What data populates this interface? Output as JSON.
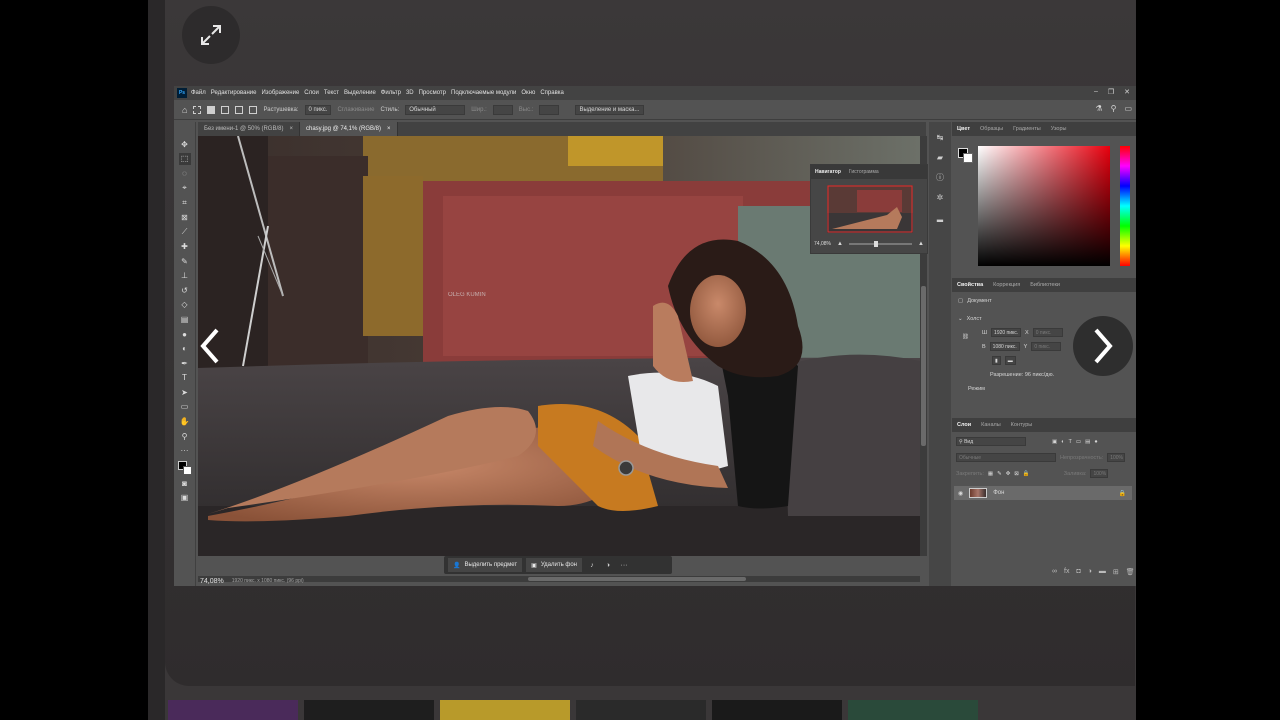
{
  "viewer": {
    "expand_icon": "expand-arrows-icon",
    "prev_icon": "chevron-left-icon",
    "next_icon": "chevron-right-icon"
  },
  "ps": {
    "logo": "Ps",
    "menu": [
      "Файл",
      "Редактирование",
      "Изображение",
      "Слои",
      "Текст",
      "Выделение",
      "Фильтр",
      "3D",
      "Просмотр",
      "Подключаемые модули",
      "Окно",
      "Справка"
    ],
    "window_controls": [
      "–",
      "❐",
      "✕"
    ],
    "options": {
      "feather_label": "Растушевка:",
      "feather_value": "0 пикс.",
      "antialias": "Сглаживание",
      "style_label": "Стиль:",
      "style_value": "Обычный",
      "width_label": "Шир.:",
      "height_label": "Выс.:",
      "select_mask_button": "Выделение и маска..."
    },
    "doc_tabs": [
      {
        "label": "Без имени-1 @ 50% (RGB/8)",
        "close": "×"
      },
      {
        "label": "chasy.jpg @ 74,1% (RGB/8)",
        "close": "×"
      }
    ],
    "status": {
      "zoom": "74,08%",
      "size": "1920 пикс. x 1080 пикс. (96 ppi)"
    },
    "context_bar": {
      "select_subject": "Выделить предмет",
      "remove_bg": "Удалить фон",
      "more": "···"
    },
    "navigator": {
      "tab_navigator": "Навигатор",
      "tab_histogram": "Гистограмма",
      "zoom": "74,08%"
    },
    "color_panel": {
      "tabs": [
        "Цвет",
        "Образцы",
        "Градиенты",
        "Узоры"
      ],
      "foreground": "#000000",
      "background": "#ffffff",
      "hue": "#e8000e"
    },
    "properties": {
      "tabs": [
        "Свойства",
        "Коррекция",
        "Библиотеки"
      ],
      "type": "Документ",
      "canvas_section": "Холст",
      "width": "1920 пикс.",
      "height": "1080 пикс.",
      "x_label": "X",
      "y_label": "Y",
      "x_value": "0 пикс.",
      "y_value": "0 пикс.",
      "w_label": "Ш",
      "h_label": "В",
      "resolution": "Разрешение: 96 пикс/дю.",
      "mode": "Режим"
    },
    "layers": {
      "tabs": [
        "Слои",
        "Каналы",
        "Контуры"
      ],
      "search_placeholder": "Вид",
      "blend_mode": "Обычные",
      "opacity_label": "Непрозрачность:",
      "opacity_value": "100%",
      "lock_label": "Закрепить:",
      "fill_label": "Заливка:",
      "fill_value": "100%",
      "layer_name": "Фон"
    }
  }
}
